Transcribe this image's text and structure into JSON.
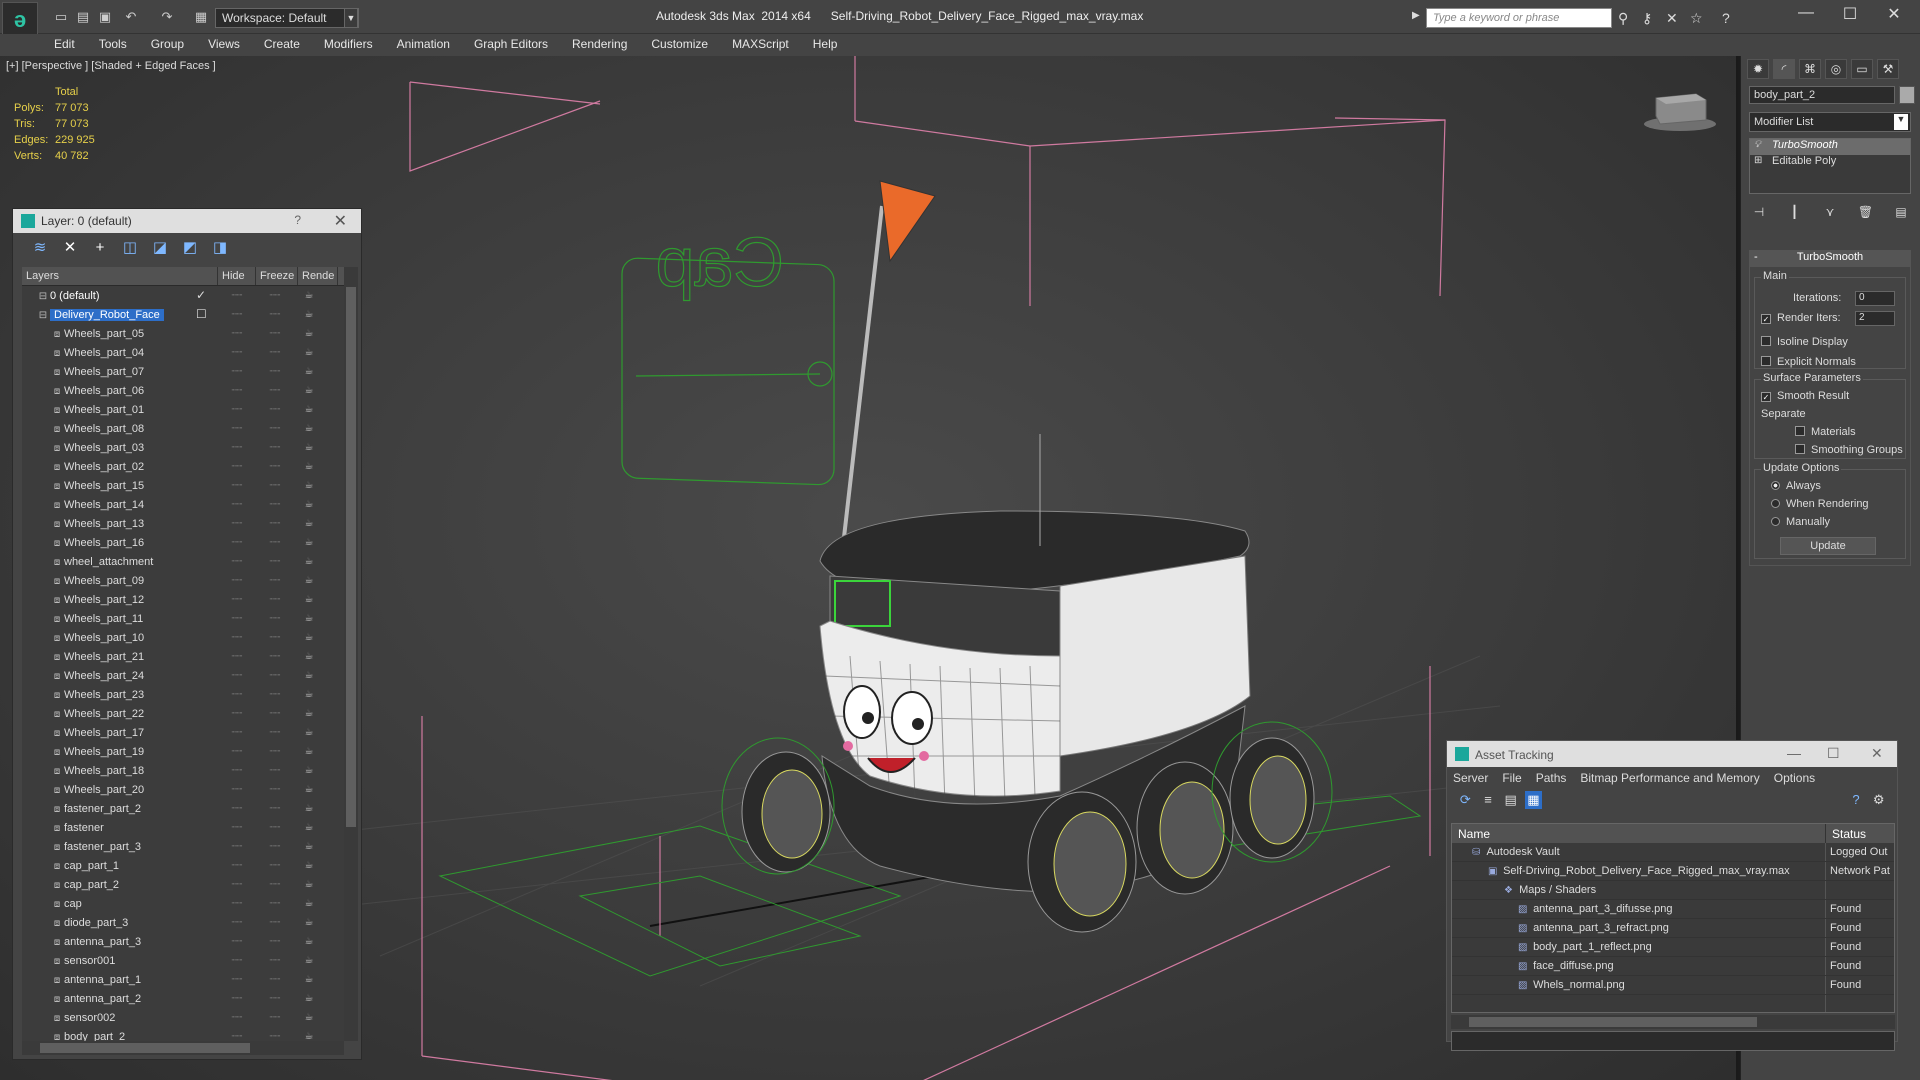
{
  "titlebar": {
    "app_title": "Autodesk 3ds Max  2014 x64      Self-Driving_Robot_Delivery_Face_Rigged_max_vray.max",
    "workspace": "Workspace: Default",
    "search_placeholder": "Type a keyword or phrase",
    "minimize": "—",
    "maximize": "☐",
    "close": "✕"
  },
  "menu": [
    "Edit",
    "Tools",
    "Group",
    "Views",
    "Create",
    "Modifiers",
    "Animation",
    "Graph Editors",
    "Rendering",
    "Customize",
    "MAXScript",
    "Help"
  ],
  "viewport": {
    "label": "[+] [Perspective ] [Shaded + Edged Faces ]",
    "stats_total": "Total",
    "stats": [
      {
        "label": "Polys:",
        "value": "77 073"
      },
      {
        "label": "Tris:",
        "value": "77 073"
      },
      {
        "label": "Edges:",
        "value": "229 925"
      },
      {
        "label": "Verts:",
        "value": "40 782"
      }
    ],
    "cap_text": "Cap"
  },
  "layer_panel": {
    "title": "Layer: 0 (default)",
    "help": "?",
    "close": "✕",
    "columns": [
      "Layers",
      "Hide",
      "Freeze",
      "Rende"
    ],
    "rows": [
      {
        "name": "0 (default)",
        "type": "default"
      },
      {
        "name": "Delivery_Robot_Face",
        "type": "selected"
      },
      {
        "name": "Wheels_part_05"
      },
      {
        "name": "Wheels_part_04"
      },
      {
        "name": "Wheels_part_07"
      },
      {
        "name": "Wheels_part_06"
      },
      {
        "name": "Wheels_part_01"
      },
      {
        "name": "Wheels_part_08"
      },
      {
        "name": "Wheels_part_03"
      },
      {
        "name": "Wheels_part_02"
      },
      {
        "name": "Wheels_part_15"
      },
      {
        "name": "Wheels_part_14"
      },
      {
        "name": "Wheels_part_13"
      },
      {
        "name": "Wheels_part_16"
      },
      {
        "name": "wheel_attachment"
      },
      {
        "name": "Wheels_part_09"
      },
      {
        "name": "Wheels_part_12"
      },
      {
        "name": "Wheels_part_11"
      },
      {
        "name": "Wheels_part_10"
      },
      {
        "name": "Wheels_part_21"
      },
      {
        "name": "Wheels_part_24"
      },
      {
        "name": "Wheels_part_23"
      },
      {
        "name": "Wheels_part_22"
      },
      {
        "name": "Wheels_part_17"
      },
      {
        "name": "Wheels_part_19"
      },
      {
        "name": "Wheels_part_18"
      },
      {
        "name": "Wheels_part_20"
      },
      {
        "name": "fastener_part_2"
      },
      {
        "name": "fastener"
      },
      {
        "name": "fastener_part_3"
      },
      {
        "name": "cap_part_1"
      },
      {
        "name": "cap_part_2"
      },
      {
        "name": "cap"
      },
      {
        "name": "diode_part_3"
      },
      {
        "name": "antenna_part_3"
      },
      {
        "name": "sensor001"
      },
      {
        "name": "antenna_part_1"
      },
      {
        "name": "antenna_part_2"
      },
      {
        "name": "sensor002"
      },
      {
        "name": "body_part_2"
      }
    ]
  },
  "command_panel": {
    "object_name": "body_part_2",
    "modifier_list": "Modifier List",
    "stack": [
      "TurboSmooth",
      "Editable Poly"
    ],
    "rollout_title": "TurboSmooth",
    "main_group": "Main",
    "iterations_label": "Iterations:",
    "iterations_value": "0",
    "render_iters_label": "Render Iters:",
    "render_iters_value": "2",
    "isoline": "Isoline Display",
    "explicit_normals": "Explicit Normals",
    "surface_group": "Surface Parameters",
    "smooth_result": "Smooth Result",
    "separate": "Separate",
    "materials": "Materials",
    "smoothing_groups": "Smoothing Groups",
    "update_group": "Update Options",
    "always": "Always",
    "when_rendering": "When Rendering",
    "manually": "Manually",
    "update_button": "Update"
  },
  "asset_tracking": {
    "title": "Asset Tracking",
    "menu": [
      "Server",
      "File",
      "Paths",
      "Bitmap Performance and Memory",
      "Options"
    ],
    "col_name": "Name",
    "col_status": "Status",
    "rows": [
      {
        "name": "Autodesk Vault",
        "status": "Logged Out"
      },
      {
        "name": "Self-Driving_Robot_Delivery_Face_Rigged_max_vray.max",
        "status": "Network Pat"
      },
      {
        "name": "Maps / Shaders",
        "status": ""
      },
      {
        "name": "antenna_part_3_difusse.png",
        "status": "Found"
      },
      {
        "name": "antenna_part_3_refract.png",
        "status": "Found"
      },
      {
        "name": "body_part_1_reflect.png",
        "status": "Found"
      },
      {
        "name": "face_diffuse.png",
        "status": "Found"
      },
      {
        "name": "Whels_normal.png",
        "status": "Found"
      }
    ]
  }
}
